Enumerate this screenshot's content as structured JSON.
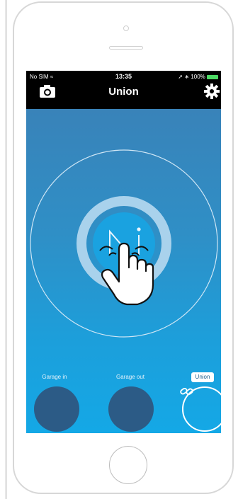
{
  "status_bar": {
    "carrier": "No SIM",
    "time": "13:35",
    "battery": "100%"
  },
  "nav": {
    "title": "Union"
  },
  "presets": [
    {
      "label": "Garage in",
      "active": false
    },
    {
      "label": "Garage out",
      "active": false
    },
    {
      "label": "Union",
      "active": true
    }
  ],
  "icons": [
    "camera-icon",
    "gear-icon",
    "wifi-icon",
    "location-icon",
    "bluetooth-icon",
    "battery-icon",
    "hand-tap-icon",
    "link-icon",
    "logo"
  ],
  "colors": {
    "screen_top": "#3c7fb5",
    "screen_bottom": "#14a8e6",
    "accent": "#1c9fdb",
    "preset_fill": "#2c5b86"
  }
}
